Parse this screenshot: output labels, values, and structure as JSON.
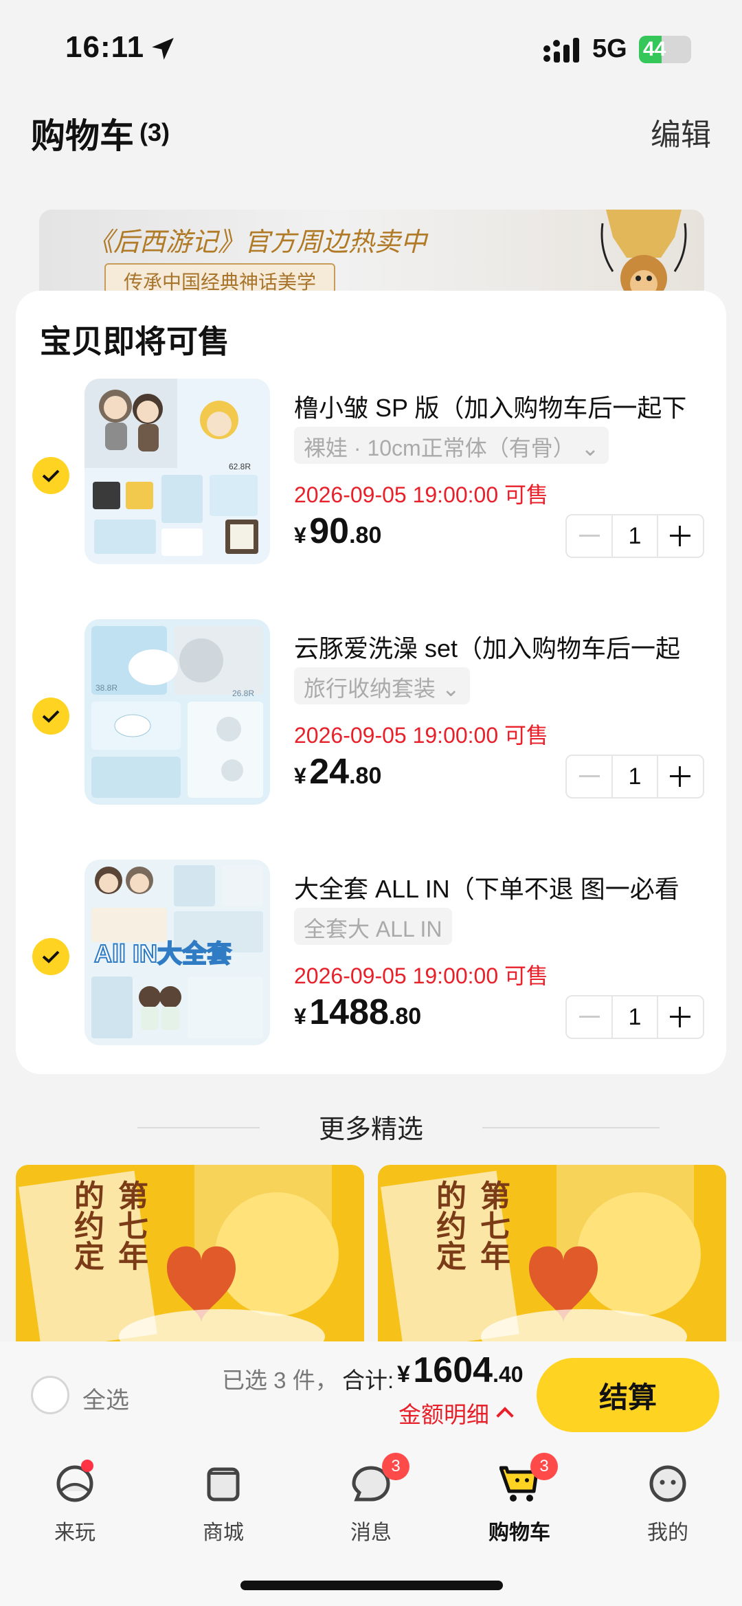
{
  "status_bar": {
    "time": "16:11",
    "network": "5G",
    "battery": "44",
    "battery_level": 0.44
  },
  "header": {
    "title": "购物车",
    "count": "(3)",
    "edit_label": "编辑"
  },
  "banner": {
    "title": "《后西游记》官方周边热卖中",
    "subtitle": "传承中国经典神话美学"
  },
  "cart": {
    "section_title": "宝贝即将可售",
    "items": [
      {
        "title": "橹小皱 SP 版（加入购物车后一起下",
        "sku": "裸娃 · 10cm正常体（有骨）",
        "sale_time": "2026-09-05 19:00:00 可售",
        "currency": "¥",
        "price_int": "90",
        "price_dec": ".80",
        "quantity": "1",
        "checked": true
      },
      {
        "title": "云豚爱洗澡 set（加入购物车后一起",
        "sku": "旅行收纳套装",
        "sale_time": "2026-09-05 19:00:00 可售",
        "currency": "¥",
        "price_int": "24",
        "price_dec": ".80",
        "quantity": "1",
        "checked": true
      },
      {
        "title": "大全套 ALL IN（下单不退 图一必看",
        "sku": "全套大 ALL IN",
        "sale_time": "2026-09-05 19:00:00 可售",
        "currency": "¥",
        "price_int": "1488",
        "price_dec": ".80",
        "quantity": "1",
        "checked": true,
        "thumb_overlay": "All IN大全套"
      }
    ]
  },
  "more": {
    "title": "更多精选"
  },
  "promos": [
    {
      "title": "第七年的约定"
    },
    {
      "title": "第七年的约定"
    }
  ],
  "checkout": {
    "select_all_label": "全选",
    "selected_info": "已选 3 件，",
    "total_label": "合计:",
    "currency": "¥",
    "total_int": "1604",
    "total_dec": ".40",
    "detail_label": "金额明细",
    "button_label": "结算"
  },
  "tabbar": {
    "items": [
      {
        "label": "来玩",
        "icon": "play-icon",
        "badge": ""
      },
      {
        "label": "商城",
        "icon": "shop-icon",
        "badge": ""
      },
      {
        "label": "消息",
        "icon": "message-icon",
        "badge": "3"
      },
      {
        "label": "购物车",
        "icon": "cart-icon",
        "badge": "3"
      },
      {
        "label": "我的",
        "icon": "profile-icon",
        "badge": ""
      }
    ]
  },
  "colors": {
    "accent": "#ffd322",
    "price_red": "#e8202a",
    "badge_red": "#ff4a4a"
  }
}
